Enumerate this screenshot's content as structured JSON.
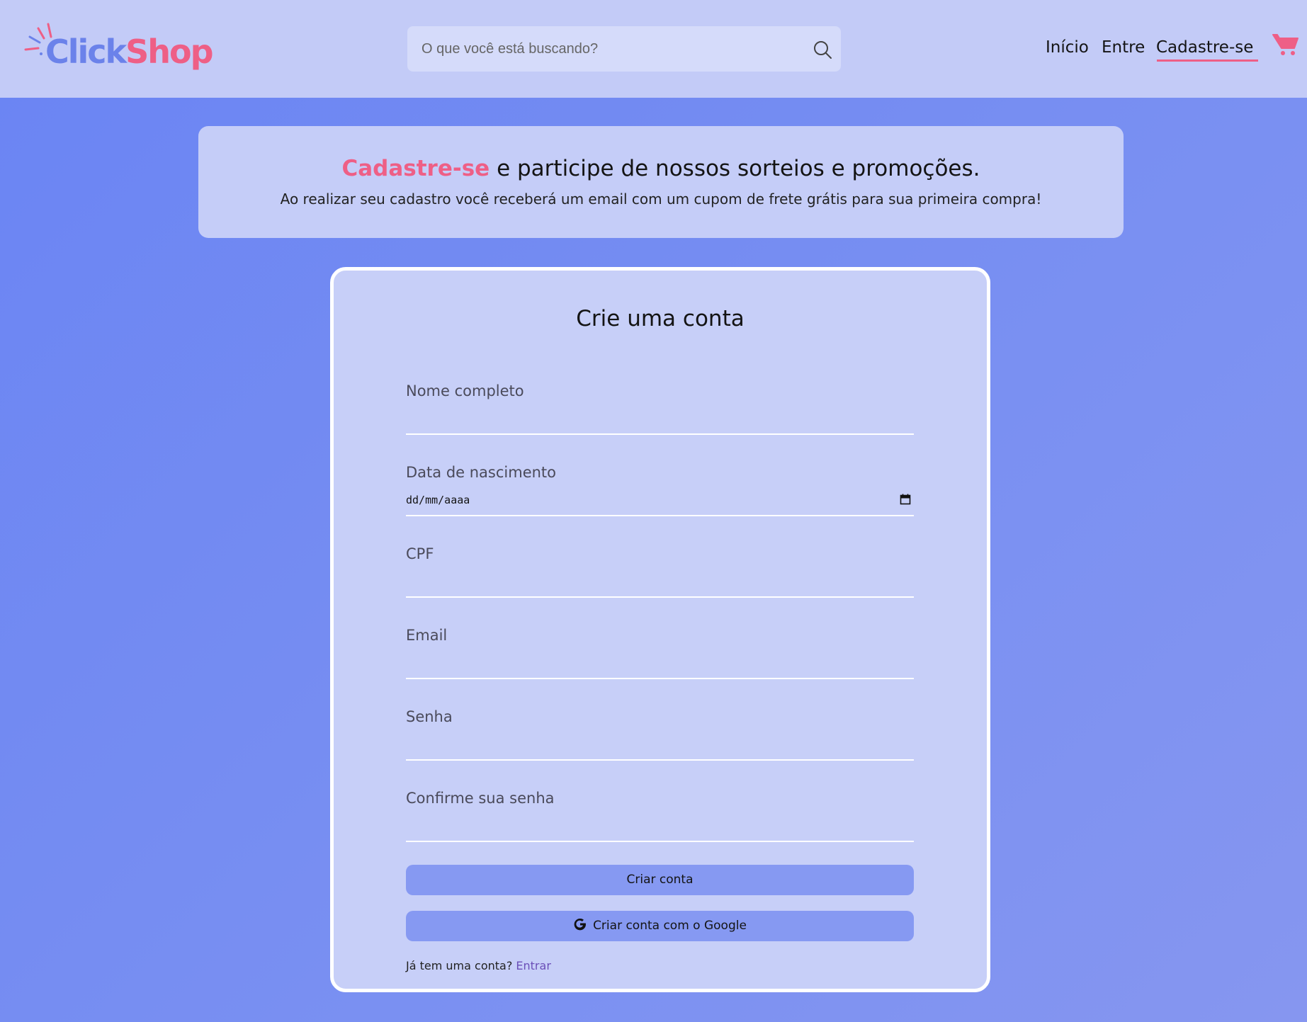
{
  "header": {
    "logo": {
      "part1": "Click",
      "part2": "Shop"
    },
    "search": {
      "placeholder": "O que você está buscando?"
    },
    "nav": {
      "inicio": "Início",
      "entre": "Entre",
      "cadastre": "Cadastre-se"
    },
    "icons": {
      "search": "search-icon",
      "cart": "cart-icon"
    }
  },
  "banner": {
    "highlight": "Cadastre-se",
    "title_rest": " e participe de nossos sorteios e promoções.",
    "subtitle": "Ao realizar seu cadastro você receberá um email com um cupom de frete grátis para sua primeira compra!"
  },
  "form": {
    "title": "Crie uma conta",
    "fields": {
      "nome": "Nome completo",
      "nascimento": "Data de nascimento",
      "nascimento_value": "dd/mm/aaaa",
      "cpf": "CPF",
      "email": "Email",
      "senha": "Senha",
      "confirma": "Confirme sua senha"
    },
    "create_button": "Criar conta",
    "google_button": "Criar conta com o Google",
    "login_prompt": "Já tem uma conta?",
    "login_link": "Entrar"
  },
  "colors": {
    "accent": "#ee5f86",
    "brand_blue": "#6b82ea",
    "button": "#8699f2"
  }
}
